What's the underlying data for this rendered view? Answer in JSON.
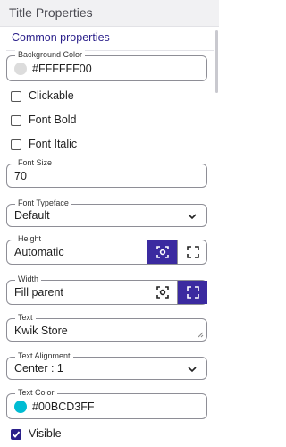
{
  "header": {
    "title": "Title Properties"
  },
  "section": {
    "title": "Common properties"
  },
  "background_color": {
    "label": "Background Color",
    "value": "#FFFFFF00",
    "swatch": "#dcdcdc"
  },
  "clickable": {
    "label": "Clickable",
    "checked": false
  },
  "font_bold": {
    "label": "Font Bold",
    "checked": false
  },
  "font_italic": {
    "label": "Font Italic",
    "checked": false
  },
  "font_size": {
    "label": "Font Size",
    "value": "70"
  },
  "font_typeface": {
    "label": "Font Typeface",
    "value": "Default",
    "icon": "chevron-down-icon"
  },
  "height": {
    "label": "Height",
    "value": "Automatic",
    "active_mode": "auto",
    "modes": [
      "auto-size-icon",
      "fill-parent-icon"
    ]
  },
  "width": {
    "label": "Width",
    "value": "Fill parent",
    "active_mode": "fill",
    "modes": [
      "auto-size-icon",
      "fill-parent-icon"
    ]
  },
  "text": {
    "label": "Text",
    "value": "Kwik Store"
  },
  "text_alignment": {
    "label": "Text Alignment",
    "value": "Center : 1",
    "icon": "chevron-down-icon"
  },
  "text_color": {
    "label": "Text Color",
    "value": "#00BCD3FF",
    "swatch": "#00bcd3"
  },
  "visible": {
    "label": "Visible",
    "checked": true
  },
  "colors": {
    "accent": "#3b2aa0",
    "section_title": "#2a1f8a",
    "header_bg": "#f1f1f3"
  }
}
